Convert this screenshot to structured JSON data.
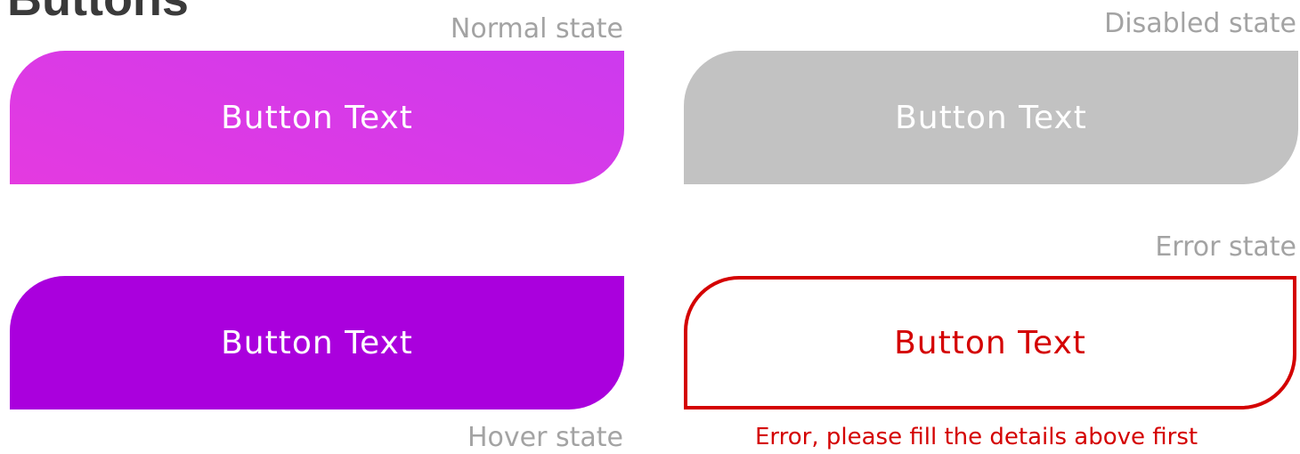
{
  "page": {
    "title": "Buttons"
  },
  "buttons": {
    "normal": {
      "state_label": "Normal state",
      "label": "Button Text"
    },
    "disabled": {
      "state_label": "Disabled state",
      "label": "Button Text"
    },
    "error": {
      "state_label": "Error  state",
      "label": "Button Text",
      "message": "Error, please fill the details above first"
    },
    "hover": {
      "state_label": "Hover state",
      "label": "Button Text"
    }
  },
  "colors": {
    "normal_gradient_start": "#e43ae0",
    "normal_gradient_end": "#cd3aee",
    "hover": "#aa00dd",
    "disabled": "#c2c2c2",
    "error": "#d40000",
    "state_label": "#a3a3a3",
    "title": "#3a3a3a"
  }
}
